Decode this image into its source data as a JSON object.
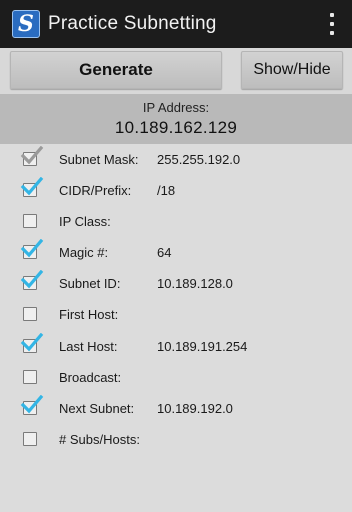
{
  "app": {
    "title": "Practice Subnetting",
    "icon_letter": "S"
  },
  "buttons": {
    "generate": "Generate",
    "show_hide": "Show/Hide"
  },
  "ip": {
    "label": "IP Address:",
    "value": "10.189.162.129"
  },
  "rows": [
    {
      "label": "Subnet Mask:",
      "value": "255.255.192.0",
      "checked": true,
      "disabled": true
    },
    {
      "label": "CIDR/Prefix:",
      "value": "/18",
      "checked": true
    },
    {
      "label": "IP Class:",
      "value": "",
      "checked": false
    },
    {
      "label": "Magic #:",
      "value": "64",
      "checked": true
    },
    {
      "label": "Subnet ID:",
      "value": "10.189.128.0",
      "checked": true
    },
    {
      "label": "First Host:",
      "value": "",
      "checked": false
    },
    {
      "label": "Last Host:",
      "value": "10.189.191.254",
      "checked": true
    },
    {
      "label": "Broadcast:",
      "value": "",
      "checked": false
    },
    {
      "label": "Next Subnet:",
      "value": "10.189.192.0",
      "checked": true
    },
    {
      "label": "# Subs/Hosts:",
      "value": "",
      "checked": false
    }
  ],
  "colors": {
    "accent": "#33b5e5",
    "disabled_check": "#9a9a9a",
    "action_bar": "#1c1c1c"
  }
}
